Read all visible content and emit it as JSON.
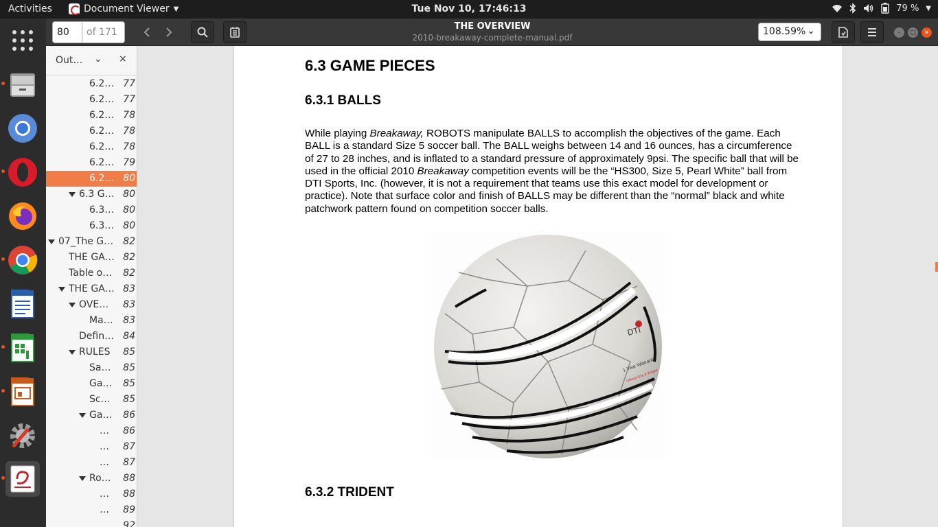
{
  "topbar": {
    "activities": "Activities",
    "app_name": "Document Viewer",
    "clock": "Tue Nov 10, 17:46:13",
    "battery": "79 %"
  },
  "dock": {
    "items": [
      "files",
      "chromium",
      "opera",
      "firefox",
      "chrome",
      "writer",
      "calc",
      "impress",
      "settings",
      "document-viewer"
    ]
  },
  "header": {
    "page_number": "80",
    "page_total": "of 171",
    "title": "THE OVERVIEW",
    "filename": "2010-breakaway-complete-manual.pdf",
    "zoom": "108.59%"
  },
  "sidebar": {
    "label": "Out…",
    "items": [
      {
        "label": "6.2…",
        "page": "77"
      },
      {
        "label": "6.2…",
        "page": "77"
      },
      {
        "label": "6.2…",
        "page": "78"
      },
      {
        "label": "6.2…",
        "page": "78"
      },
      {
        "label": "6.2…",
        "page": "78"
      },
      {
        "label": "6.2…",
        "page": "79"
      },
      {
        "label": "6.2…",
        "page": "80"
      },
      {
        "label": "6.3 G…",
        "page": "80"
      },
      {
        "label": "6.3…",
        "page": "80"
      },
      {
        "label": "6.3…",
        "page": "80"
      },
      {
        "label": "07_The G…",
        "page": "82"
      },
      {
        "label": "THE GA…",
        "page": "82"
      },
      {
        "label": "Table o…",
        "page": "82"
      },
      {
        "label": "THE GA…",
        "page": "83"
      },
      {
        "label": "OVE…",
        "page": "83"
      },
      {
        "label": "Ma…",
        "page": "83"
      },
      {
        "label": "Defin…",
        "page": "84"
      },
      {
        "label": "RULES",
        "page": "85"
      },
      {
        "label": "Sa…",
        "page": "85"
      },
      {
        "label": "Ga…",
        "page": "85"
      },
      {
        "label": "Sc…",
        "page": "85"
      },
      {
        "label": "Ga…",
        "page": "86"
      },
      {
        "label": "…",
        "page": "86"
      },
      {
        "label": "…",
        "page": "87"
      },
      {
        "label": "…",
        "page": "87"
      },
      {
        "label": "Ro…",
        "page": "88"
      },
      {
        "label": "…",
        "page": "88"
      },
      {
        "label": "…",
        "page": "89"
      },
      {
        "label": "",
        "page": "92"
      }
    ]
  },
  "document": {
    "heading": "6.3 GAME PIECES",
    "subheading": "6.3.1 BALLS",
    "para_1": "While playing ",
    "para_em_1": "Breakaway,",
    "para_2": " ROBOTS manipulate BALLS to accomplish the objectives of the game. Each BALL is a standard Size 5 soccer ball.  The BALL weighs between 14 and 16 ounces, has a circumference of 27 to 28 inches, and is inflated to a standard pressure of approximately 9psi.  The specific ball that will be used in the official 2010 ",
    "para_em_2": "Breakaway",
    "para_3": " competition events will be the “HS300, Size 5, Pearl White” ball from DTI Sports, Inc. (however, it is not a requirement that teams use this exact model for development or practice).  Note that surface color and finish of BALLS may be different than the “normal” black and white patchwork pattern found on competition soccer balls.",
    "ball_brand": "DTI",
    "ball_warranty": "1 Year Warranty",
    "ball_official": "Official Size & Weight",
    "subheading_2": "6.3.2 TRIDENT"
  }
}
